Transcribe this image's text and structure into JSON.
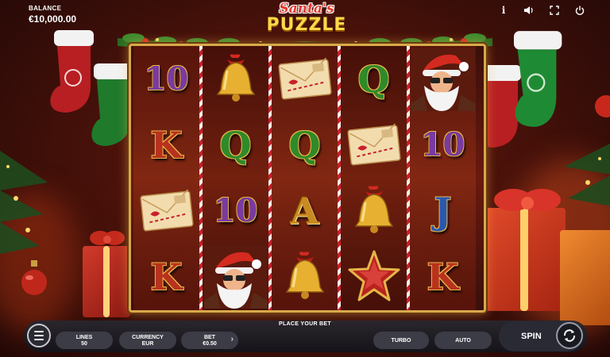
{
  "game": {
    "title_line1": "Santa's",
    "title_line2": "PUZZLE"
  },
  "balance": {
    "label": "BALANCE",
    "value": "€10,000.00"
  },
  "top_icons": [
    "info-icon",
    "sound-icon",
    "fullscreen-icon",
    "power-icon"
  ],
  "top_icon_glyphs": {
    "info": "i",
    "sound": "◁)",
    "fullscreen": "⤢",
    "power": "⏻"
  },
  "reels": [
    [
      "10",
      "K",
      "letter",
      "K"
    ],
    [
      "bell",
      "Q",
      "10",
      "santa"
    ],
    [
      "letter",
      "Q",
      "A",
      "bell"
    ],
    [
      "Q",
      "letter",
      "bell",
      "star"
    ],
    [
      "santa",
      "10",
      "J",
      "K"
    ]
  ],
  "symbol_labels": {
    "10": "10",
    "K": "K",
    "Q": "Q",
    "A": "A",
    "J": "J"
  },
  "bottom_bar": {
    "prompt": "PLACE YOUR BET",
    "lines_label": "LINES",
    "lines_value": "50",
    "currency_label": "CURRENCY",
    "currency_value": "EUR",
    "bet_label": "BET",
    "bet_value": "€0.50",
    "bet_chevron": "›",
    "turbo_label": "TURBO",
    "auto_label": "AUTO",
    "spin_label": "SPIN"
  },
  "colors": {
    "frame_gold": "#d8a94a",
    "bar_bg": "#2a2a32",
    "accent_blue": "#7ad0ff"
  }
}
